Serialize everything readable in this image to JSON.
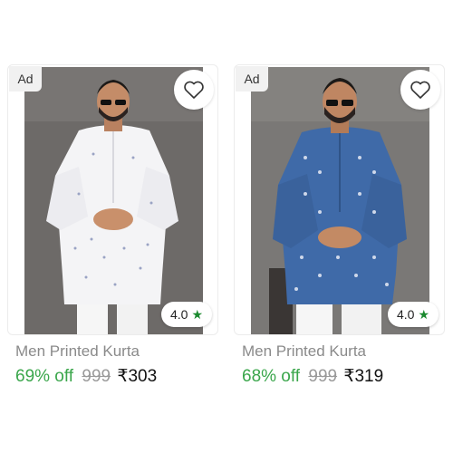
{
  "products": [
    {
      "ad_label": "Ad",
      "title": "Men Printed Kurta",
      "discount": "69% off",
      "mrp": "999",
      "price": "₹303",
      "rating": "4.0",
      "kurta_color": "#f4f4f6",
      "bg_color": "#6f6c6a",
      "wishlist_icon": "heart-outline-icon",
      "rating_icon": "star-icon"
    },
    {
      "ad_label": "Ad",
      "title": "Men Printed Kurta",
      "discount": "68% off",
      "mrp": "999",
      "price": "₹319",
      "rating": "4.0",
      "kurta_color": "#3f6aa8",
      "bg_color": "#7c7a78",
      "wishlist_icon": "heart-outline-icon",
      "rating_icon": "star-icon"
    }
  ],
  "colors": {
    "discount": "#3aa64b",
    "star": "#1b8a2f",
    "title": "#8a8a8a"
  }
}
